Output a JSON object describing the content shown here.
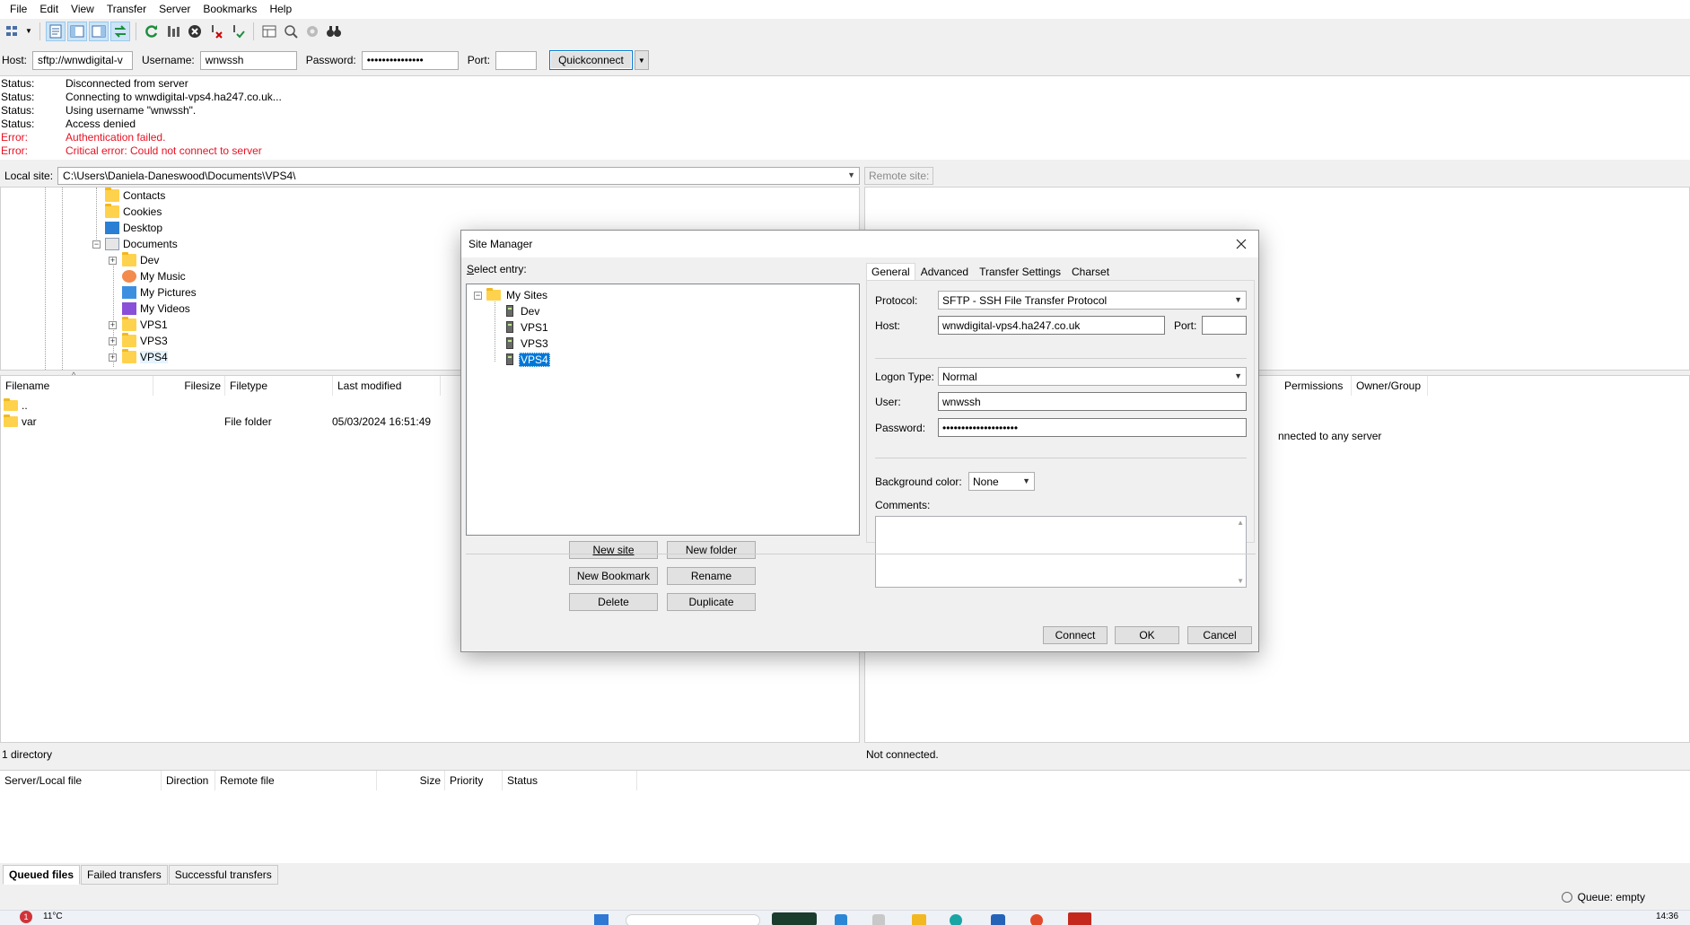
{
  "menu": [
    "File",
    "Edit",
    "View",
    "Transfer",
    "Server",
    "Bookmarks",
    "Help"
  ],
  "quickconnect": {
    "host_label": "Host:",
    "host_value": "sftp://wnwdigital-v",
    "username_label": "Username:",
    "username_value": "wnwssh",
    "password_label": "Password:",
    "password_value": "•••••••••••••••",
    "port_label": "Port:",
    "port_value": "",
    "button_label": "Quickconnect"
  },
  "log": [
    {
      "key": "Status:",
      "msg": "Disconnected from server",
      "type": "status"
    },
    {
      "key": "Status:",
      "msg": "Connecting to wnwdigital-vps4.ha247.co.uk...",
      "type": "status"
    },
    {
      "key": "Status:",
      "msg": "Using username \"wnwssh\".",
      "type": "status"
    },
    {
      "key": "Status:",
      "msg": "Access denied",
      "type": "status"
    },
    {
      "key": "Error:",
      "msg": "Authentication failed.",
      "type": "error"
    },
    {
      "key": "Error:",
      "msg": "Critical error: Could not connect to server",
      "type": "error"
    }
  ],
  "local": {
    "site_label": "Local site:",
    "path": "C:\\Users\\Daniela-Daneswood\\Documents\\VPS4\\",
    "tree": [
      "Contacts",
      "Cookies",
      "Desktop",
      "Documents",
      "Dev",
      "My Music",
      "My Pictures",
      "My Videos",
      "VPS1",
      "VPS3",
      "VPS4"
    ],
    "columns": [
      "Filename",
      "Filesize",
      "Filetype",
      "Last modified"
    ],
    "files": [
      {
        "name": "..",
        "size": "",
        "type": "",
        "modified": ""
      },
      {
        "name": "var",
        "size": "",
        "type": "File folder",
        "modified": "05/03/2024 16:51:49"
      }
    ],
    "status": "1 directory"
  },
  "remote": {
    "site_label": "Remote site:",
    "columns": [
      "Permissions",
      "Owner/Group"
    ],
    "empty_msg": "nnected to any server",
    "status": "Not connected."
  },
  "queue": {
    "columns": [
      "Server/Local file",
      "Direction",
      "Remote file",
      "Size",
      "Priority",
      "Status"
    ],
    "tabs": [
      "Queued files",
      "Failed transfers",
      "Successful transfers"
    ],
    "status": "Queue: empty"
  },
  "taskbar": {
    "temp": "11°C",
    "time": "14:36",
    "badge": "1"
  },
  "dialog": {
    "title": "Site Manager",
    "select_entry": "Select entry:",
    "tree": {
      "root": "My Sites",
      "sites": [
        "Dev",
        "VPS1",
        "VPS3",
        "VPS4"
      ],
      "selected": "VPS4"
    },
    "buttons": {
      "new_site": "New site",
      "new_folder": "New folder",
      "new_bookmark": "New Bookmark",
      "rename": "Rename",
      "delete": "Delete",
      "duplicate": "Duplicate"
    },
    "tabs": [
      "General",
      "Advanced",
      "Transfer Settings",
      "Charset"
    ],
    "general": {
      "protocol_label": "Protocol:",
      "protocol_value": "SFTP - SSH File Transfer Protocol",
      "host_label": "Host:",
      "host_value": "wnwdigital-vps4.ha247.co.uk",
      "port_label": "Port:",
      "port_value": "",
      "logon_label": "Logon Type:",
      "logon_value": "Normal",
      "user_label": "User:",
      "user_value": "wnwssh",
      "password_label": "Password:",
      "password_value": "••••••••••••••••••••",
      "bg_label": "Background color:",
      "bg_value": "None",
      "comments_label": "Comments:"
    },
    "footer": {
      "connect": "Connect",
      "ok": "OK",
      "cancel": "Cancel"
    }
  }
}
